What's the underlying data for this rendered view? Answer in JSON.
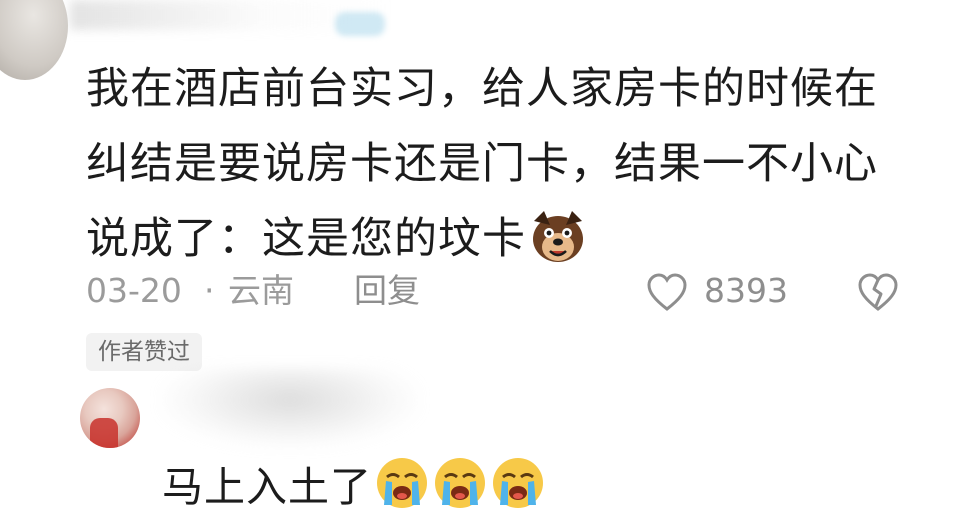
{
  "comment": {
    "text": "我在酒店前台实习，给人家房卡的时候在纠结是要说房卡还是门卡，结果一不小心说成了：这是您的坟卡",
    "emoji": "dog-face-emoji",
    "date": "03-20",
    "separator": "·",
    "region": "云南",
    "reply_label": "回复",
    "like_count": "8393",
    "author_liked_badge": "作者赞过"
  },
  "reply": {
    "text": "马上入土了",
    "emojis": [
      "crying-emoji",
      "crying-emoji",
      "crying-emoji"
    ]
  },
  "colors": {
    "text": "#1c1c1c",
    "meta": "#9b9b9b",
    "badge_bg": "#f2f2f2"
  }
}
